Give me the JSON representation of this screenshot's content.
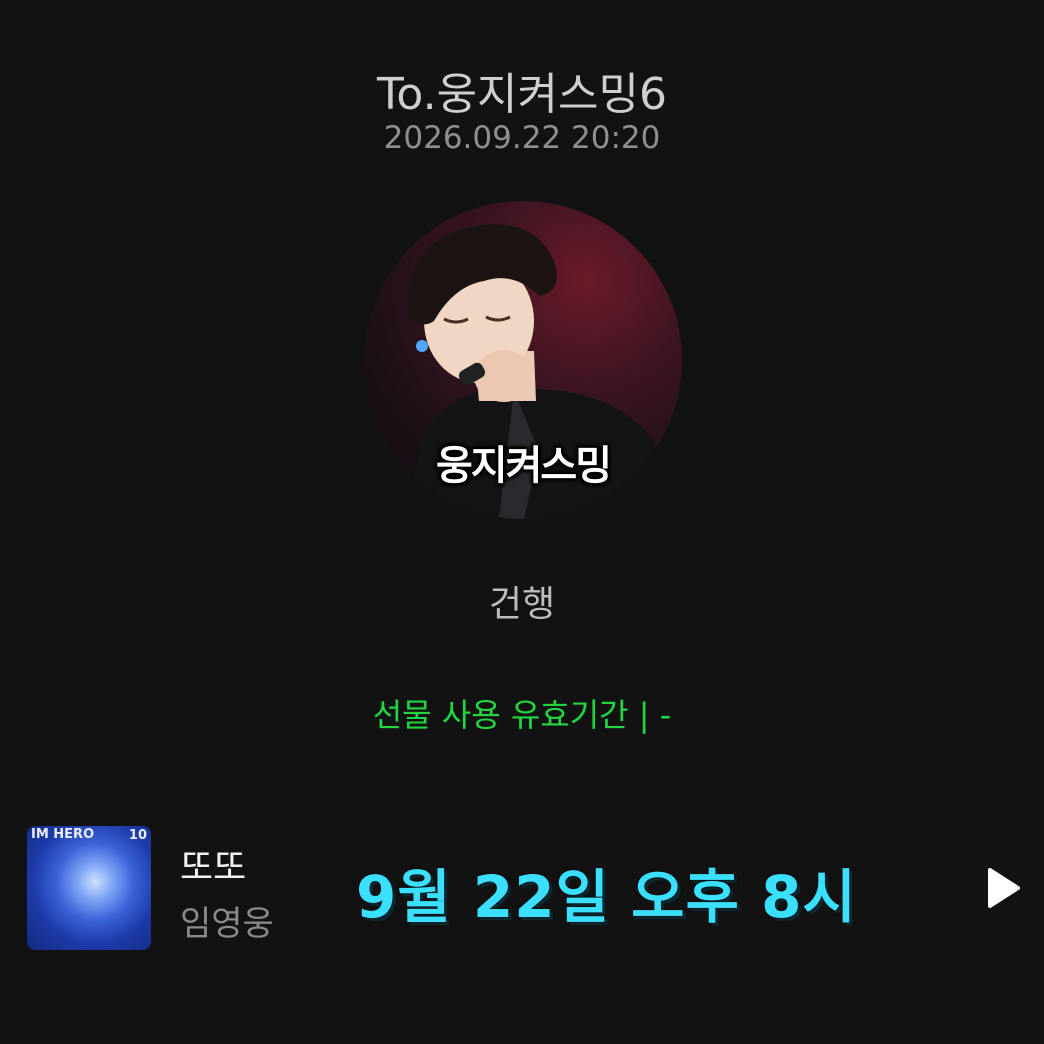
{
  "header": {
    "title": "To.웅지켜스밍6",
    "datetime": "2026.09.22 20:20"
  },
  "profile": {
    "caption": "웅지켜스밍"
  },
  "message": "건행",
  "validity": {
    "text": "선물 사용 유효기간 |   -",
    "color": "#22d642"
  },
  "music": {
    "album_label": "IM HERO",
    "album_number": "10",
    "song_title": "또또",
    "artist": "임영웅",
    "banner_text": "9월 22일 오후 8시",
    "banner_color": "#3ce0ff",
    "play_icon": "play-icon"
  }
}
